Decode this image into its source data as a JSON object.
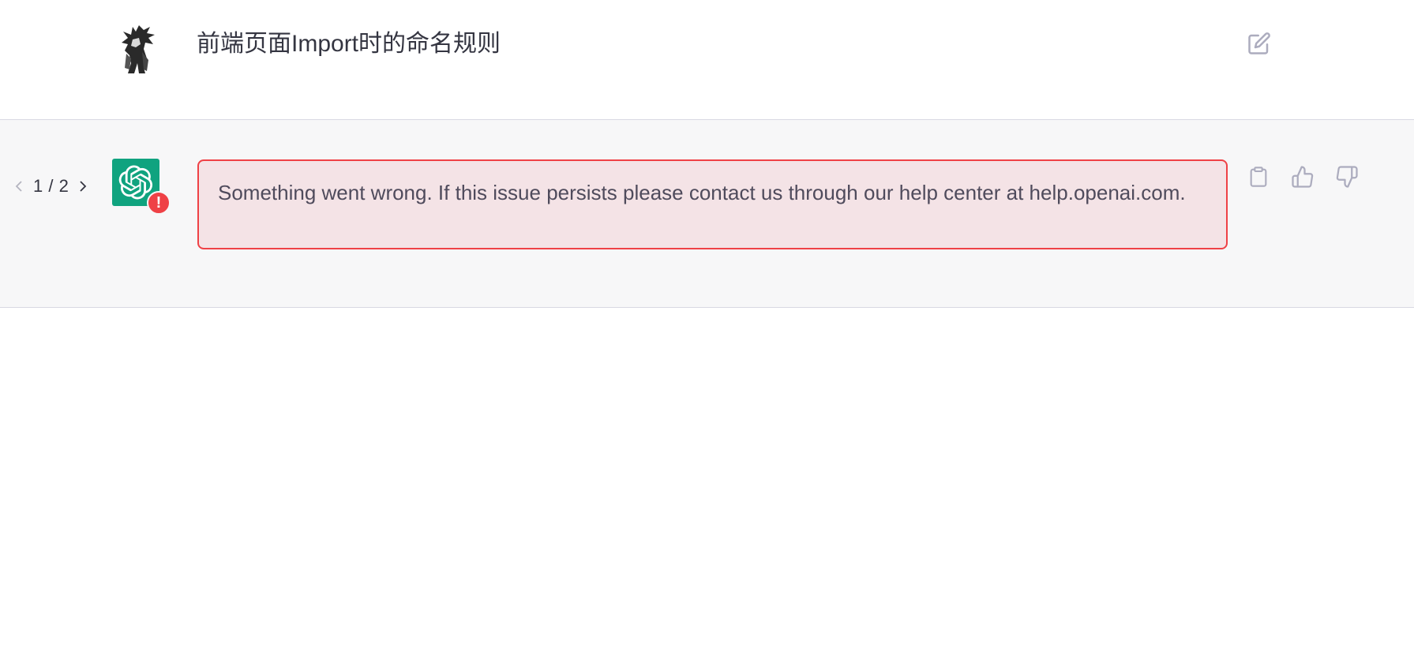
{
  "user_message": {
    "text": "前端页面Import时的命名规则",
    "avatar_icon": "user-avatar-ink-figure",
    "edit_icon": "edit-icon"
  },
  "assistant_message": {
    "pager": {
      "text": "1 / 2",
      "prev_icon": "chevron-left-icon",
      "next_icon": "chevron-right-icon"
    },
    "avatar_icon": "openai-logo-icon",
    "error_badge": "!",
    "error_text": "Something went wrong. If this issue persists please contact us through our help center at help.openai.com.",
    "actions": {
      "copy_icon": "clipboard-icon",
      "like_icon": "thumbs-up-icon",
      "dislike_icon": "thumbs-down-icon"
    }
  },
  "colors": {
    "accent": "#10a37f",
    "error": "#ef4146",
    "error_bg": "#f4e3e6",
    "assistant_bg": "#f7f7f8"
  }
}
